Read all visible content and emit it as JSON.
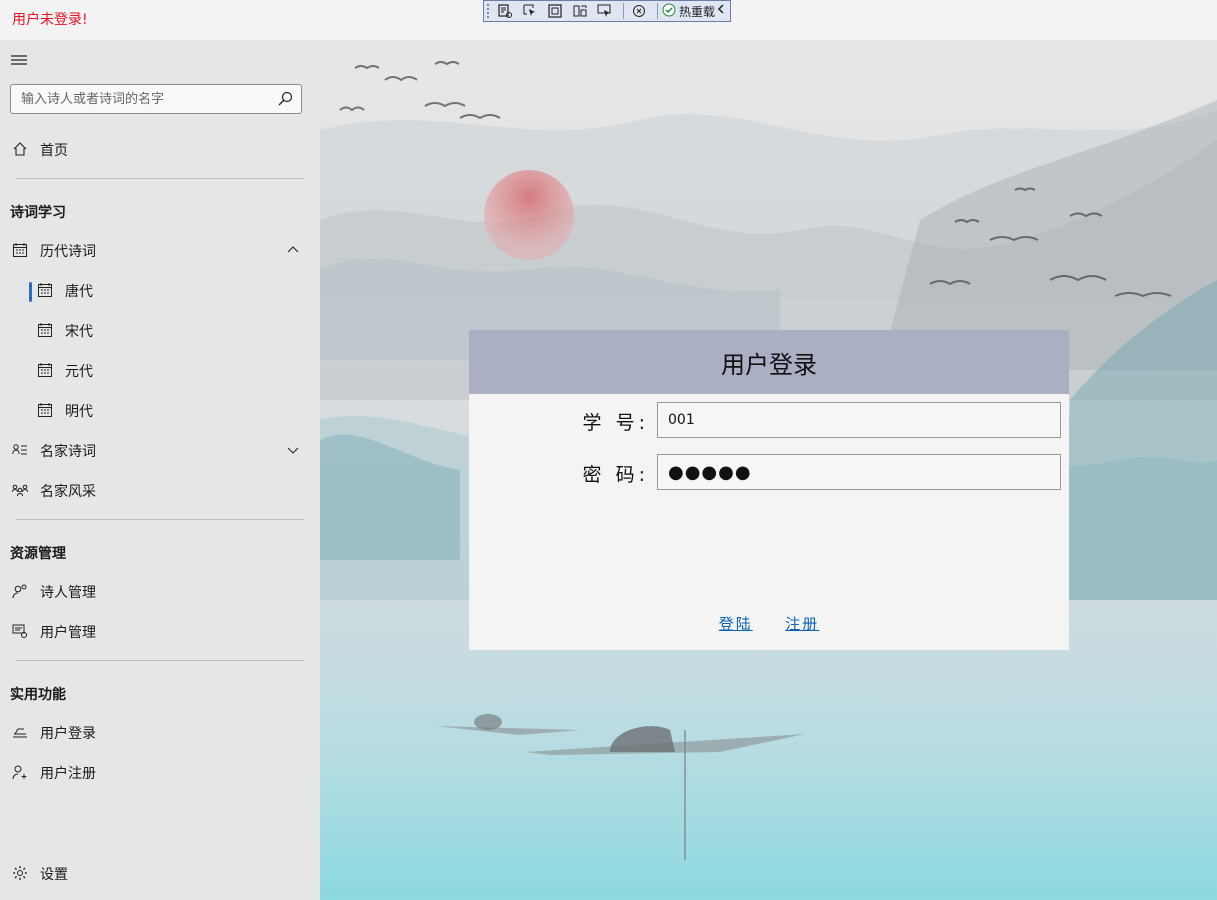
{
  "titlebar": {
    "status_text": "用户未登录!",
    "devtools": {
      "hot_reload_label": "热重载"
    }
  },
  "sidebar": {
    "search": {
      "placeholder": "输入诗人或者诗词的名字"
    },
    "home_label": "首页",
    "sections": {
      "poetry": "诗词学习",
      "resources": "资源管理",
      "utilities": "实用功能"
    },
    "items": {
      "dynasty_poems": "历代诗词",
      "tang": "唐代",
      "song": "宋代",
      "yuan": "元代",
      "ming": "明代",
      "famous_poems": "名家诗词",
      "famous_style": "名家风采",
      "poet_mgmt": "诗人管理",
      "user_mgmt": "用户管理",
      "user_login": "用户登录",
      "user_register": "用户注册",
      "settings": "设置"
    }
  },
  "login": {
    "title": "用户登录",
    "student_id_label": "学 号:",
    "student_id_value": "001",
    "password_label": "密 码:",
    "password_value": "●●●●●",
    "login_link": "登陆",
    "register_link": "注册"
  },
  "colors": {
    "status_text": "#e81123",
    "accent": "#2b6fbf",
    "link": "#0a62b5",
    "login_header": "#abafc4"
  }
}
